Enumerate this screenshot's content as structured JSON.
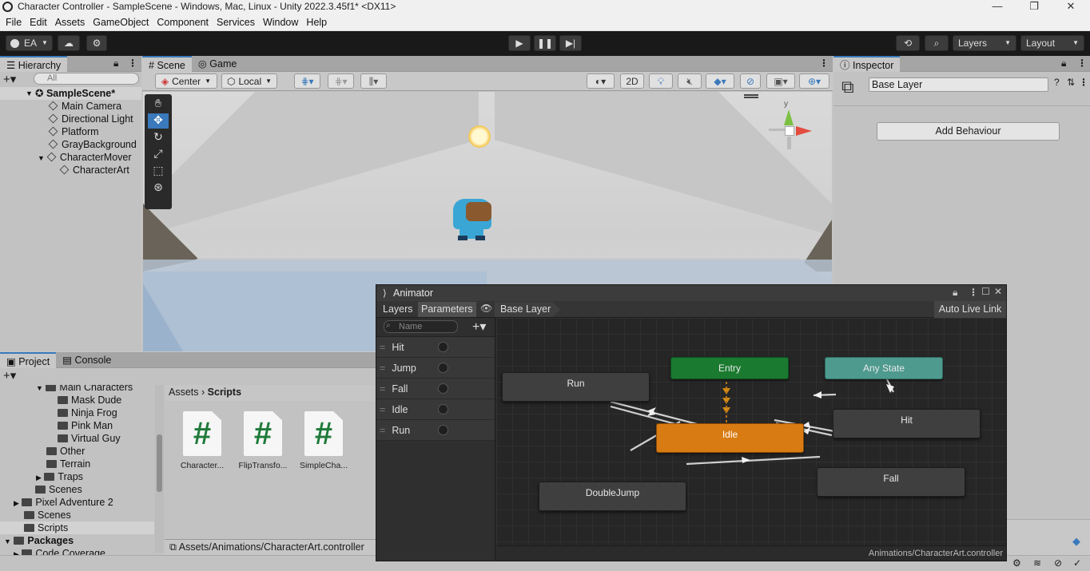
{
  "window": {
    "title": "Character Controller - SampleScene - Windows, Mac, Linux - Unity 2022.3.45f1* <DX11>"
  },
  "menu": [
    "File",
    "Edit",
    "Assets",
    "GameObject",
    "Component",
    "Services",
    "Window",
    "Help"
  ],
  "toolbar": {
    "account": "EA",
    "layers_label": "Layers",
    "layout_label": "Layout"
  },
  "hierarchy": {
    "tab": "Hierarchy",
    "search_placeholder": "All",
    "scene": "SampleScene*",
    "items": [
      "Main Camera",
      "Directional Light",
      "Platform",
      "GrayBackground",
      "CharacterMover",
      "CharacterArt"
    ]
  },
  "scene_view": {
    "tabs": [
      "Scene",
      "Game"
    ],
    "pivot": "Center",
    "space": "Local",
    "mode_2d": "2D",
    "gizmo_y": "y"
  },
  "inspector": {
    "tab": "Inspector",
    "name": "Base Layer",
    "add_behaviour": "Add Behaviour"
  },
  "project": {
    "tabs": [
      "Project",
      "Console"
    ],
    "tree": [
      "Main Characters",
      "Mask Dude",
      "Ninja Frog",
      "Pink Man",
      "Virtual Guy",
      "Other",
      "Terrain",
      "Traps",
      "Scenes",
      "Pixel Adventure 2",
      "Scenes",
      "Scripts",
      "Packages",
      "Code Coverage"
    ],
    "breadcrumb": [
      "Assets",
      "Scripts"
    ],
    "assets": [
      "Character...",
      "FlipTransfo...",
      "SimpleCha..."
    ],
    "asset_glyph": "#",
    "path": "Assets/Animations/CharacterArt.controller"
  },
  "animator": {
    "title": "Animator",
    "tabs": [
      "Layers",
      "Parameters"
    ],
    "layer": "Base Layer",
    "live_link": "Auto Live Link",
    "search_placeholder": "Name",
    "parameters": [
      "Hit",
      "Jump",
      "Fall",
      "Idle",
      "Run"
    ],
    "states": {
      "entry": "Entry",
      "any": "Any State",
      "idle": "Idle",
      "run": "Run",
      "hit": "Hit",
      "fall": "Fall",
      "doublejump": "DoubleJump"
    },
    "footer_path": "Animations/CharacterArt.controller",
    "colors": {
      "entry": "#1a7a2f",
      "any": "#4e9a8f",
      "idle": "#d97b13",
      "state": "#3f3f3f"
    }
  }
}
